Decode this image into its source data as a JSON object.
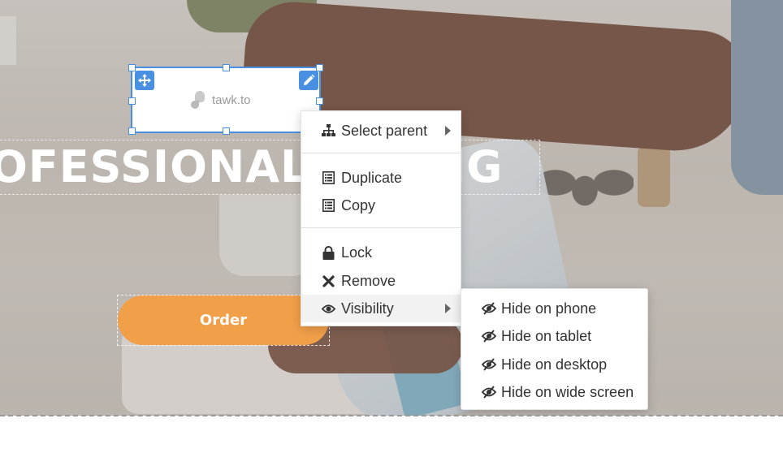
{
  "hero": {
    "headline": "OFESSIONAL C    NING",
    "order_label": "Order"
  },
  "widget": {
    "logo_text": "tawk.to"
  },
  "context_menu": {
    "items": [
      {
        "label": "Select parent",
        "icon": "sitemap-icon",
        "has_submenu": true
      },
      {
        "label": "Duplicate",
        "icon": "list-icon",
        "has_submenu": false
      },
      {
        "label": "Copy",
        "icon": "list-icon",
        "has_submenu": false
      },
      {
        "label": "Lock",
        "icon": "lock-icon",
        "has_submenu": false
      },
      {
        "label": "Remove",
        "icon": "close-icon",
        "has_submenu": false
      },
      {
        "label": "Visibility",
        "icon": "eye-icon",
        "has_submenu": true
      }
    ]
  },
  "visibility_submenu": {
    "items": [
      {
        "label": "Hide on phone",
        "icon": "eye-slash-icon"
      },
      {
        "label": "Hide on tablet",
        "icon": "eye-slash-icon"
      },
      {
        "label": "Hide on desktop",
        "icon": "eye-slash-icon"
      },
      {
        "label": "Hide on wide screen",
        "icon": "eye-slash-icon"
      }
    ]
  },
  "colors": {
    "accent": "#4a90e2",
    "order_button": "#f19f49",
    "menu_text": "#333333"
  }
}
